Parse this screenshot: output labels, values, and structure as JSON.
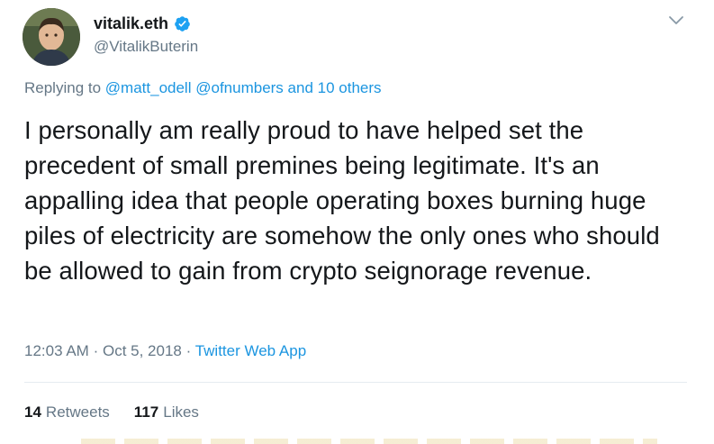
{
  "tweet": {
    "display_name": "vitalik.eth",
    "handle": "@VitalikButerin",
    "replying_prefix": "Replying to",
    "reply_mentions": [
      "@matt_odell",
      "@ofnumbers"
    ],
    "reply_and": "and",
    "reply_others": "10 others",
    "text": "I personally am really proud to have helped set the precedent of small premines being legitimate. It's an appalling idea that people operating boxes burning huge piles of electricity are somehow the only ones who should be allowed to gain from crypto seignorage revenue.",
    "time": "12:03 AM",
    "separator": "·",
    "date": "Oct 5, 2018",
    "source": "Twitter Web App",
    "retweets_count": "14",
    "retweets_label": "Retweets",
    "likes_count": "117",
    "likes_label": "Likes"
  },
  "colors": {
    "link": "#1b95e0",
    "secondary_text": "#657786",
    "verified": "#1da1f2"
  },
  "icons": {
    "verified": "verified-badge-icon",
    "caret": "chevron-down-icon"
  }
}
